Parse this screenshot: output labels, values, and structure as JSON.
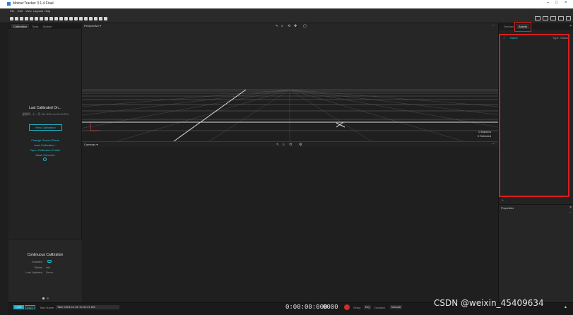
{
  "window": {
    "title": "Motive:Tracker 3.1.4 Final"
  },
  "menu": [
    "File",
    "Edit",
    "View",
    "Layouts",
    "Help"
  ],
  "left_panel": {
    "tabs": [
      "Calibration",
      "Tools",
      "Builder"
    ],
    "last_calibrated_title": "Last Calibrated On...",
    "last_calibrated_sub": "星期四, 十一月 28, 2024 at 03:40 PM",
    "new_calibration": "New Calibration",
    "links": [
      "Change Ground Plane",
      "Load Calibration...",
      "Open Calibration Folder",
      "Mask Cameras"
    ],
    "continuous": {
      "title": "Continuous Calibration",
      "enabled_label": "Enabled",
      "status_label": "Status",
      "status_value": "Idle",
      "last_updated_label": "Last Updated",
      "last_updated_value": "Never"
    }
  },
  "viewport": {
    "label": "Perspective ▾",
    "markers": "0 Markers",
    "selected": "0 Selected",
    "more": "···"
  },
  "cameras": {
    "label": "Cameras ▾",
    "more": "···"
  },
  "right_panel": {
    "tabs": [
      "Devices",
      "Assets"
    ],
    "columns": [
      "Name",
      "Type",
      "Status"
    ],
    "properties_title": "Properties"
  },
  "bottom_bar": {
    "live": "LIVE",
    "edit": "EDIT",
    "take_name_label": "Take Name",
    "take_name_value": "Take 2024-12-02 10:41:21 AM",
    "timecode": "0:00:00:000",
    "frame": "0000",
    "setup_label": "Setup",
    "setup_value": "Dry",
    "duration_label": "Duration",
    "duration_value": "Manual"
  },
  "watermark": "CSDN @weixin_45409634",
  "colors": {
    "accent": "#1ec6d6",
    "highlight_box": "#d81e1e",
    "record": "#d42a2a"
  }
}
